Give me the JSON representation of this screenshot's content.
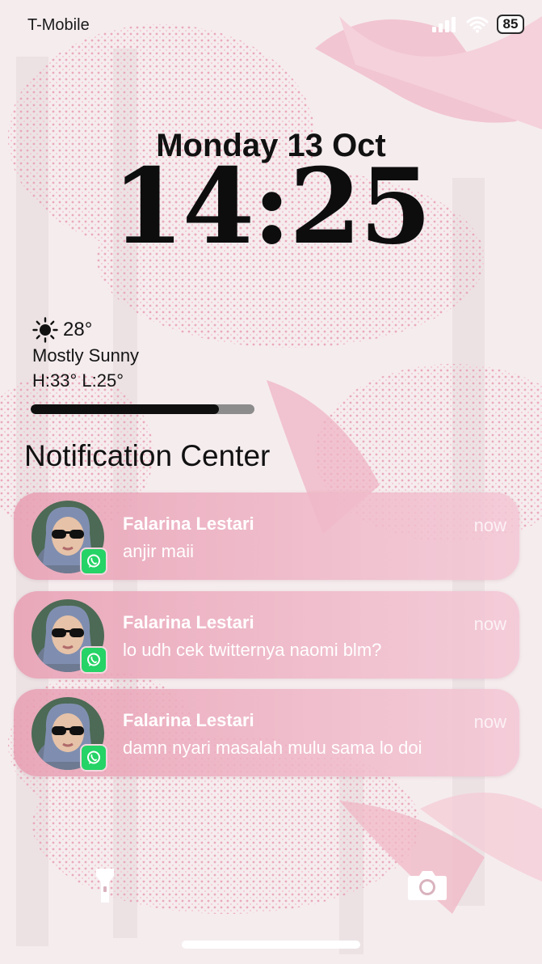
{
  "status_bar": {
    "carrier": "T-Mobile",
    "battery": "85"
  },
  "lock_screen": {
    "date": "Monday 13 Oct",
    "time": "14:25"
  },
  "weather": {
    "icon": "sun-icon",
    "temperature": "28°",
    "condition": "Mostly Sunny",
    "high_low": "H:33° L:25°",
    "progress_fraction": 0.84
  },
  "notification_center": {
    "title": "Notification Center",
    "notifications": [
      {
        "sender": "Falarina Lestari",
        "message": "anjir maii",
        "time": "now",
        "app": "whatsapp-icon"
      },
      {
        "sender": "Falarina Lestari",
        "message": "lo udh cek twitternya naomi blm?",
        "time": "now",
        "app": "whatsapp-icon"
      },
      {
        "sender": "Falarina Lestari",
        "message": "damn nyari masalah mulu sama lo doi",
        "time": "now",
        "app": "whatsapp-icon"
      }
    ]
  },
  "colors": {
    "accent": "#f2b8c8",
    "notification_bg": "#eaa6bb",
    "whatsapp": "#25d366"
  }
}
